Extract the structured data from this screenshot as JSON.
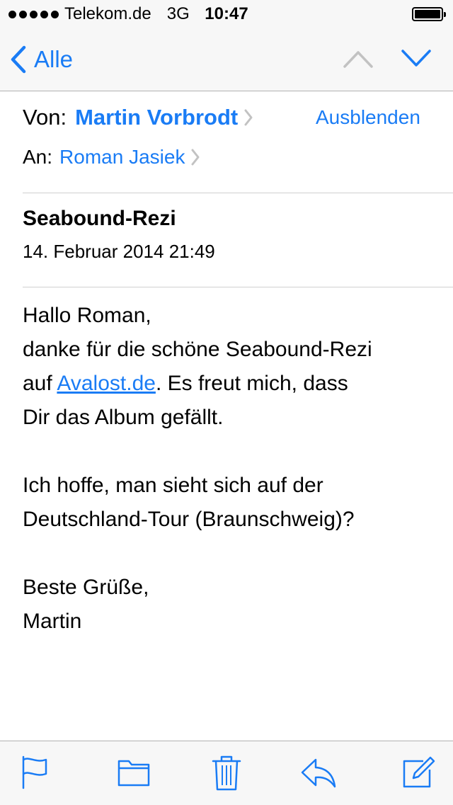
{
  "status": {
    "carrier": "Telekom.de",
    "network": "3G",
    "time": "10:47"
  },
  "nav": {
    "back_label": "Alle"
  },
  "header": {
    "from_label": "Von:",
    "from_name": "Martin Vorbrodt",
    "hide_label": "Ausblenden",
    "to_label": "An:",
    "to_name": "Roman Jasiek"
  },
  "message": {
    "subject": "Seabound-Rezi",
    "date": "14. Februar 2014 21:49",
    "greeting": "Hallo Roman,",
    "line1": "danke für die schöne Seabound-Rezi",
    "line2_prefix": "auf ",
    "link_text": "Avalost.de",
    "line2_suffix": ".  Es freut mich, dass",
    "line3": "Dir das Album gefällt.",
    "line4": "Ich hoffe, man sieht sich auf der",
    "line5": "Deutschland-Tour (Braunschweig)?",
    "closing": "Beste Grüße,",
    "signature": "Martin"
  },
  "colors": {
    "accent": "#1a7cf5",
    "bar_background": "#f7f7f7"
  },
  "toolbar": {
    "icons": [
      "flag-icon",
      "folder-icon",
      "trash-icon",
      "reply-icon",
      "compose-icon"
    ]
  }
}
